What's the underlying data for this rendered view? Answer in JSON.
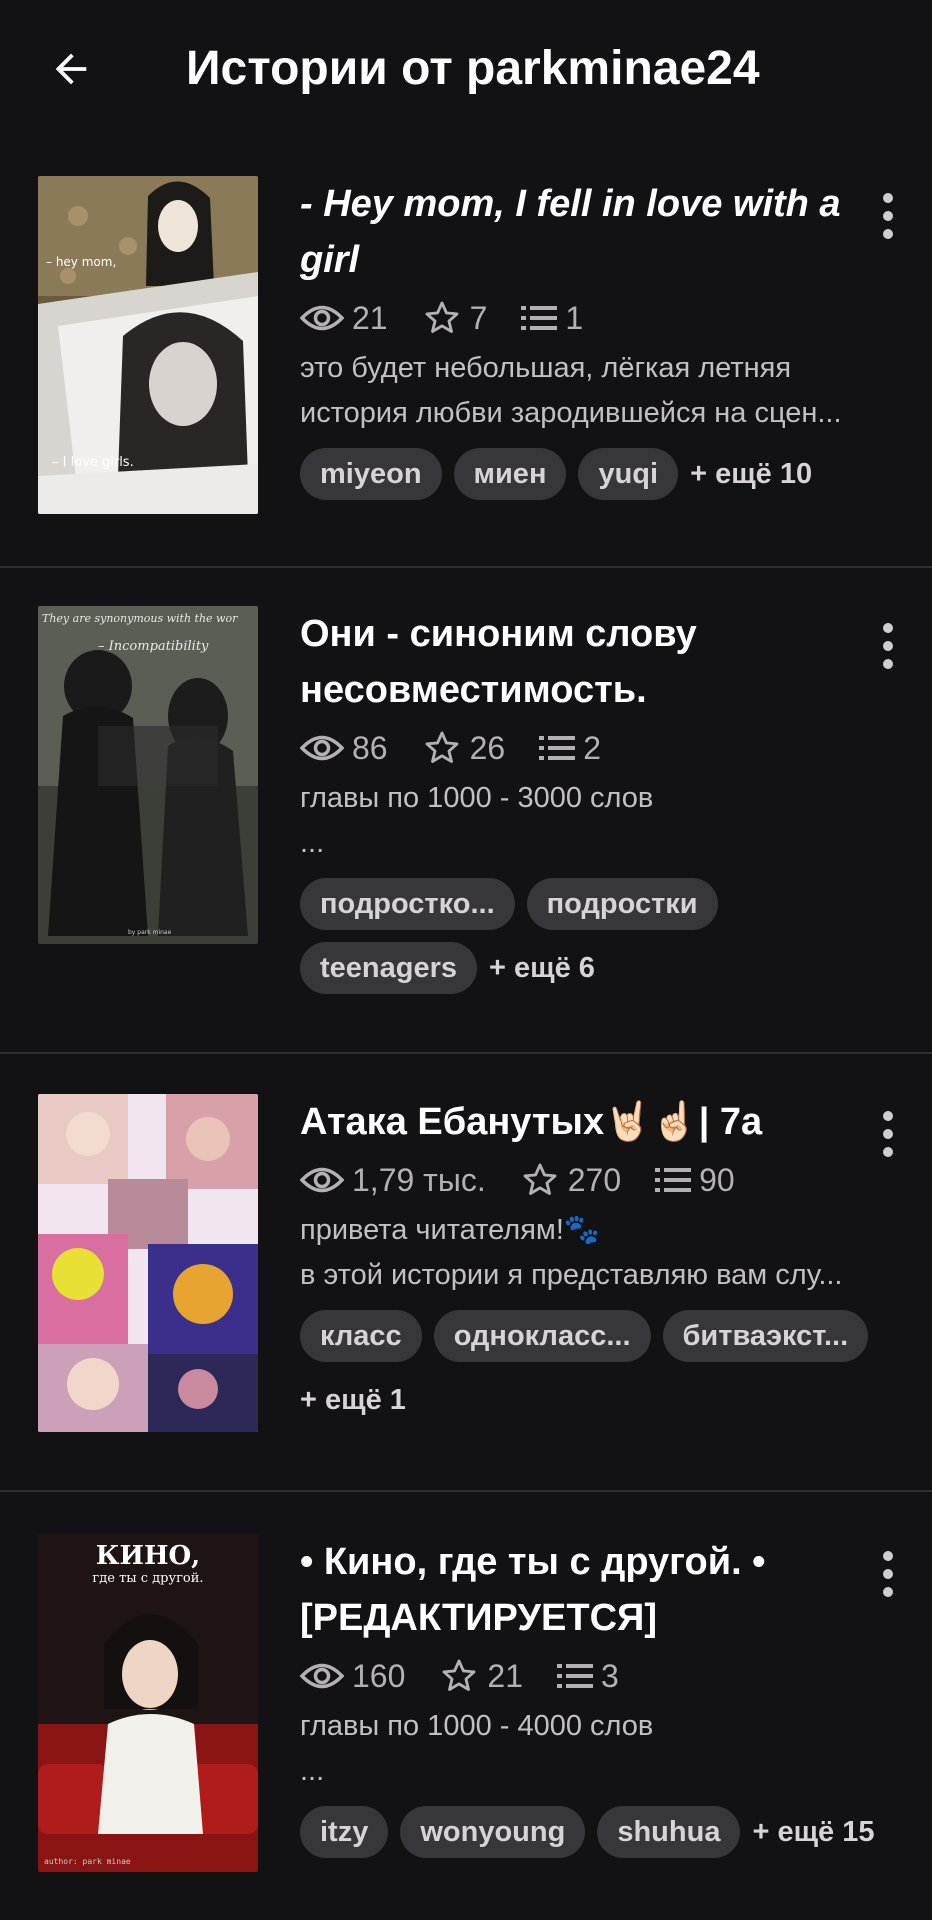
{
  "header": {
    "title": "Истории от parkminae24"
  },
  "stories": [
    {
      "title": "- Hey mom, I fell in love with a girl",
      "italic": true,
      "reads": "21",
      "votes": "7",
      "parts": "1",
      "desc_lines": [
        "это будет небольшая, лёгкая летняя",
        "история любви зародившейся на сцен..."
      ],
      "tags": [
        "miyeon",
        "миен",
        "yuqi"
      ],
      "more": "+ ещё 10",
      "cover_text": [
        "– hey mom,",
        "– I love girls."
      ]
    },
    {
      "title": "Они - синоним слову несовместимость.",
      "reads": "86",
      "votes": "26",
      "parts": "2",
      "desc_lines": [
        "главы по 1000 - 3000 слов",
        "..."
      ],
      "tags": [
        "подростко...",
        "подростки",
        "teenagers"
      ],
      "more": "+ ещё 6",
      "cover_text": [
        "They are synonymous with the wor",
        "– Incompatibility",
        "by park minae"
      ]
    },
    {
      "title": "Атака Ебанутых🤘🏻☝🏻| 7а",
      "reads": "1,79 тыс.",
      "votes": "270",
      "parts": "90",
      "desc_lines": [
        "привета читателям!🐾",
        "в этой истории я представляю вам слу..."
      ],
      "tags": [
        "класс",
        "однокласс...",
        "битваэкст..."
      ],
      "more": "+ ещё 1"
    },
    {
      "title": "• Кино, где ты с другой. • [РЕДАКТИРУЕТСЯ]",
      "reads": "160",
      "votes": "21",
      "parts": "3",
      "desc_lines": [
        "главы по 1000 - 4000 слов",
        "..."
      ],
      "tags": [
        "itzy",
        "wonyoung",
        "shuhua"
      ],
      "more": "+ ещё 15",
      "cover_text": [
        "КИНО,",
        "где ты с другой.",
        "author: park minae"
      ]
    }
  ],
  "colors": {
    "background": "#121113",
    "tag_bg": "#37363a",
    "muted": "#b3b1b6"
  }
}
